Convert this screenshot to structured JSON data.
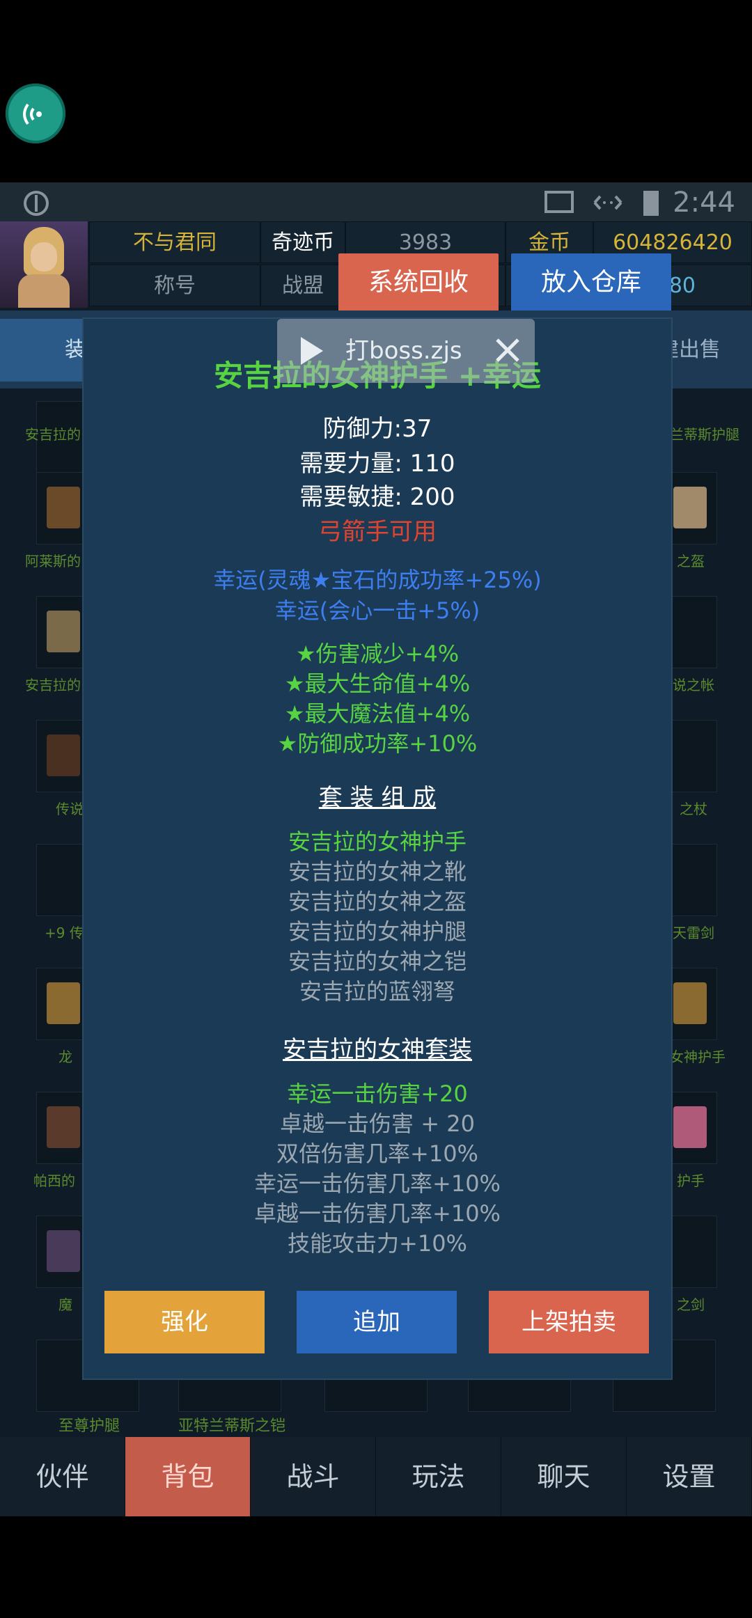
{
  "status": {
    "time": "2:44"
  },
  "header": {
    "player_name": "不与君同",
    "coin_label": "奇迹币",
    "coin_value": "3983",
    "gold_label": "金币",
    "gold_value": "604826420",
    "title_label": "称号",
    "alliance_label": "战盟",
    "partial_value": "80",
    "recycle_button": "系统回收",
    "store_button": "放入仓库"
  },
  "tabs": {
    "left_partial": "装",
    "right_partial": "建出售"
  },
  "inventory_labels": [
    "安吉拉的",
    "兰蒂斯护腿",
    "阿莱斯的",
    "之盔",
    "安吉拉的",
    "说之帐",
    "传说",
    "之杖",
    "+9 传",
    "天雷剑",
    "龙",
    "女神护手",
    "帕西的",
    "护手",
    "魔",
    "之剑",
    "至尊护腿",
    "亚特兰蒂斯之铠"
  ],
  "video_tag": {
    "label": "打boss.zjs"
  },
  "item": {
    "name": "安吉拉的女神护手 +幸运",
    "defense": "防御力:37",
    "req_strength": "需要力量: 110",
    "req_agility": "需要敏捷: 200",
    "class_req": "弓箭手可用",
    "luck_lines": [
      "幸运(灵魂★宝石的成功率+25%)",
      "幸运(会心一击+5%)"
    ],
    "excellent_lines": [
      "★伤害减少+4%",
      "★最大生命值+4%",
      "★最大魔法值+4%",
      "★防御成功率+10%"
    ],
    "set_title": "套 装 组 成",
    "set_items": [
      "安吉拉的女神护手",
      "安吉拉的女神之靴",
      "安吉拉的女神之盔",
      "安吉拉的女神护腿",
      "安吉拉的女神之铠",
      "安吉拉的蓝翎弩"
    ],
    "set_name": "安吉拉的女神套装",
    "set_bonuses": [
      "幸运一击伤害+20",
      "卓越一击伤害 + 20",
      "双倍伤害几率+10%",
      "幸运一击伤害几率+10%",
      "卓越一击伤害几率+10%",
      "技能攻击力+10%"
    ]
  },
  "modal_buttons": {
    "enhance": "强化",
    "append": "追加",
    "auction": "上架拍卖"
  },
  "nav": [
    "伙伴",
    "背包",
    "战斗",
    "玩法",
    "聊天",
    "设置"
  ],
  "colors": {
    "green": "#58d342",
    "blue": "#3d7ef0",
    "red": "#e0442f",
    "gold": "#d6b43a"
  }
}
